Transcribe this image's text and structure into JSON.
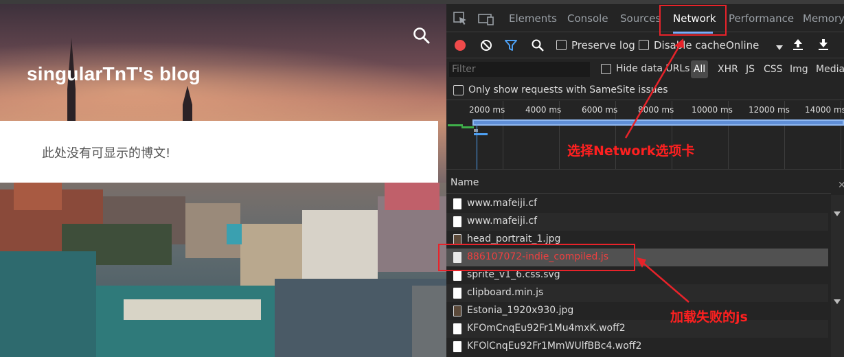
{
  "blog": {
    "title": "singularTnT's blog",
    "empty_message": "此处没有可显示的博文!"
  },
  "devtools": {
    "tabs": [
      "Elements",
      "Console",
      "Sources",
      "Network",
      "Performance",
      "Memory"
    ],
    "active_tab": "Network",
    "toolbar": {
      "preserve_log": "Preserve log",
      "disable_cache": "Disable cache",
      "throttle": "Online"
    },
    "filter": {
      "placeholder": "Filter",
      "hide_data_urls": "Hide data URLs",
      "types": [
        "All",
        "XHR",
        "JS",
        "CSS",
        "Img",
        "Media"
      ]
    },
    "samesite_label": "Only show requests with SameSite issues",
    "timeline_ticks": [
      "2000 ms",
      "4000 ms",
      "6000 ms",
      "8000 ms",
      "10000 ms",
      "12000 ms",
      "14000 ms"
    ],
    "table": {
      "name_header": "Name",
      "rows": [
        {
          "name": "www.mafeiji.cf",
          "status": "ok"
        },
        {
          "name": "www.mafeiji.cf",
          "status": "ok"
        },
        {
          "name": "head_portrait_1.jpg",
          "status": "ok"
        },
        {
          "name": "886107072-indie_compiled.js",
          "status": "failed"
        },
        {
          "name": "sprite_v1_6.css.svg",
          "status": "ok"
        },
        {
          "name": "clipboard.min.js",
          "status": "ok"
        },
        {
          "name": "Estonia_1920x930.jpg",
          "status": "ok"
        },
        {
          "name": "KFOmCnqEu92Fr1Mu4mxK.woff2",
          "status": "ok"
        },
        {
          "name": "KFOlCnqEu92Fr1MmWUlfBBc4.woff2",
          "status": "ok"
        }
      ]
    }
  },
  "annotations": {
    "network_note": "选择Network选项卡",
    "failed_note": "加载失败的js"
  },
  "colors": {
    "devtools_bg": "#242424",
    "record_red": "#f04a4a",
    "active_tab_underline": "#7cacf8",
    "failed_text": "#ee4040",
    "annotation_red": "#e8232a",
    "filter_icon_blue": "#4ea1f5"
  }
}
